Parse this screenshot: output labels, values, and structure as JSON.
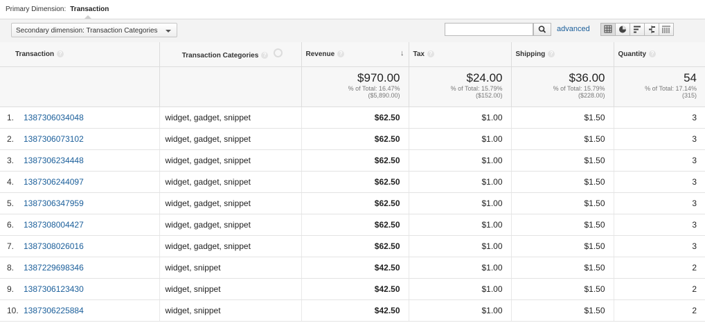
{
  "primary_dimension": {
    "label": "Primary Dimension:",
    "value": "Transaction"
  },
  "toolbar": {
    "secondary_dimension": "Secondary dimension: Transaction Categories",
    "search_value": "",
    "advanced_label": "advanced",
    "views": [
      "table-icon",
      "pie-icon",
      "performance-icon",
      "comparison-icon",
      "pivot-icon"
    ]
  },
  "columns": {
    "transaction": "Transaction",
    "categories": "Transaction Categories",
    "revenue": "Revenue",
    "tax": "Tax",
    "shipping": "Shipping",
    "quantity": "Quantity"
  },
  "totals": {
    "revenue": {
      "value": "$970.00",
      "pct": "% of Total: 16.47%",
      "total": "($5,890.00)"
    },
    "tax": {
      "value": "$24.00",
      "pct": "% of Total: 15.79%",
      "total": "($152.00)"
    },
    "shipping": {
      "value": "$36.00",
      "pct": "% of Total: 15.79%",
      "total": "($228.00)"
    },
    "quantity": {
      "value": "54",
      "pct": "% of Total: 17.14%",
      "total": "(315)"
    }
  },
  "rows": [
    {
      "index": "1.",
      "transaction": "1387306034048",
      "categories": "widget, gadget, snippet",
      "revenue": "$62.50",
      "tax": "$1.00",
      "shipping": "$1.50",
      "quantity": "3"
    },
    {
      "index": "2.",
      "transaction": "1387306073102",
      "categories": "widget, gadget, snippet",
      "revenue": "$62.50",
      "tax": "$1.00",
      "shipping": "$1.50",
      "quantity": "3"
    },
    {
      "index": "3.",
      "transaction": "1387306234448",
      "categories": "widget, gadget, snippet",
      "revenue": "$62.50",
      "tax": "$1.00",
      "shipping": "$1.50",
      "quantity": "3"
    },
    {
      "index": "4.",
      "transaction": "1387306244097",
      "categories": "widget, gadget, snippet",
      "revenue": "$62.50",
      "tax": "$1.00",
      "shipping": "$1.50",
      "quantity": "3"
    },
    {
      "index": "5.",
      "transaction": "1387306347959",
      "categories": "widget, gadget, snippet",
      "revenue": "$62.50",
      "tax": "$1.00",
      "shipping": "$1.50",
      "quantity": "3"
    },
    {
      "index": "6.",
      "transaction": "1387308004427",
      "categories": "widget, gadget, snippet",
      "revenue": "$62.50",
      "tax": "$1.00",
      "shipping": "$1.50",
      "quantity": "3"
    },
    {
      "index": "7.",
      "transaction": "1387308026016",
      "categories": "widget, gadget, snippet",
      "revenue": "$62.50",
      "tax": "$1.00",
      "shipping": "$1.50",
      "quantity": "3"
    },
    {
      "index": "8.",
      "transaction": "1387229698346",
      "categories": "widget, snippet",
      "revenue": "$42.50",
      "tax": "$1.00",
      "shipping": "$1.50",
      "quantity": "2"
    },
    {
      "index": "9.",
      "transaction": "1387306123430",
      "categories": "widget, snippet",
      "revenue": "$42.50",
      "tax": "$1.00",
      "shipping": "$1.50",
      "quantity": "2"
    },
    {
      "index": "10.",
      "transaction": "1387306225884",
      "categories": "widget, snippet",
      "revenue": "$42.50",
      "tax": "$1.00",
      "shipping": "$1.50",
      "quantity": "2"
    }
  ]
}
